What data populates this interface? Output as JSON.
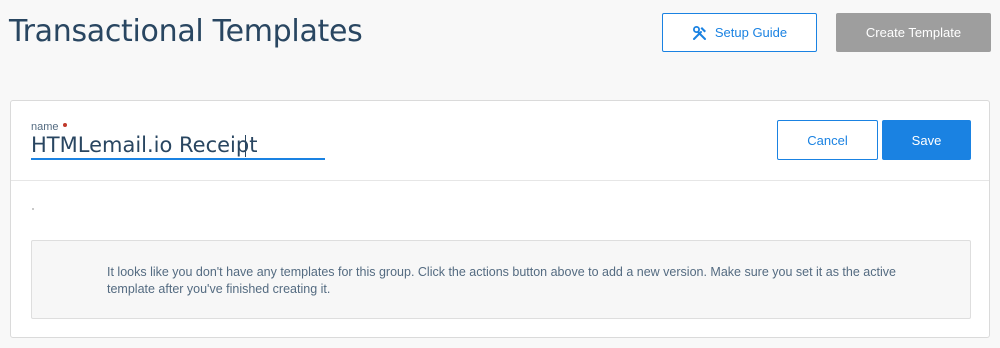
{
  "header": {
    "title": "Transactional Templates",
    "setup_guide_label": "Setup Guide",
    "setup_guide_icon": "tools-icon",
    "create_template_label": "Create Template"
  },
  "editor": {
    "name_label": "name",
    "name_value": "HTMLemail.io Receipt",
    "cancel_label": "Cancel",
    "save_label": "Save"
  },
  "empty_state": {
    "message": "It looks like you don't have any templates for this group. Click the actions button above to add a new version. Make sure you set it as the active template after you've finished creating it."
  },
  "colors": {
    "accent": "#1a82e2",
    "disabled_button": "#9e9e9e",
    "required_marker": "#c0392b"
  }
}
